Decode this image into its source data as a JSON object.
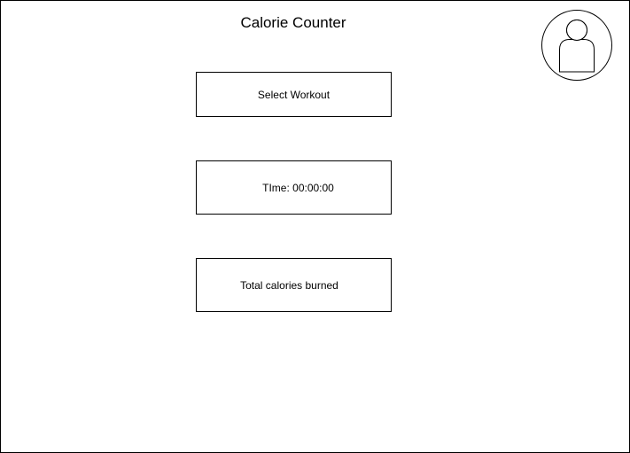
{
  "header": {
    "title": "Calorie Counter"
  },
  "profile": {
    "icon": "user-avatar-icon"
  },
  "main": {
    "select_workout_label": "Select Workout",
    "time_label": "TIme: 00:00:00",
    "total_calories_label": "Total calories burned"
  }
}
